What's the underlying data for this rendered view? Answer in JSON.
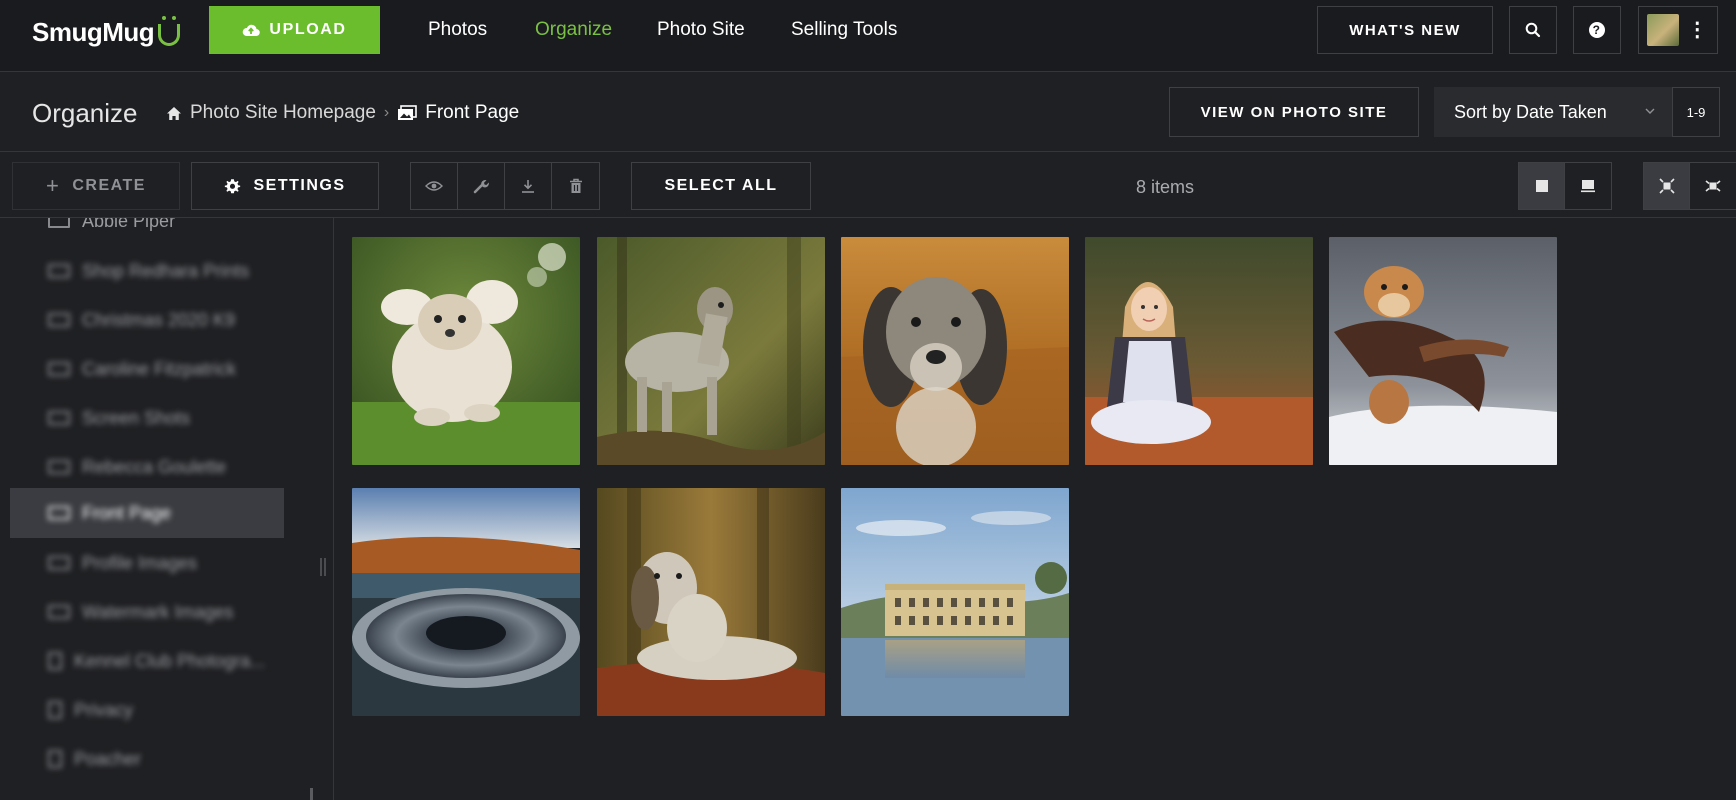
{
  "app": {
    "logo_text": "SmugMug",
    "upload_label": "UPLOAD",
    "nav": [
      {
        "label": "Photos",
        "active": false
      },
      {
        "label": "Organize",
        "active": true
      },
      {
        "label": "Photo Site",
        "active": false
      },
      {
        "label": "Selling Tools",
        "active": false
      }
    ],
    "whats_new_label": "WHAT'S NEW",
    "accent_color": "#7ac143"
  },
  "header": {
    "title": "Organize",
    "breadcrumb": [
      {
        "label": "Photo Site Homepage",
        "icon": "home-icon"
      },
      {
        "label": "Front Page",
        "icon": "gallery-icon"
      }
    ],
    "view_on_site_label": "VIEW ON PHOTO SITE",
    "sort_label": "Sort by Date Taken",
    "range_label": "1-9"
  },
  "toolbar": {
    "create_label": "CREATE",
    "settings_label": "SETTINGS",
    "tools": [
      "eye-icon",
      "wrench-icon",
      "download-icon",
      "trash-icon"
    ],
    "select_all_label": "SELECT ALL",
    "item_count": "8 items",
    "view_modes": [
      "large-thumbnail-icon",
      "details-icon"
    ],
    "fit_modes": [
      "fill-icon",
      "fit-icon"
    ]
  },
  "sidebar": {
    "items": [
      {
        "label": "Abbie Piper",
        "icon": "gallery-icon",
        "active": false
      },
      {
        "label": "Shop Redhara Prints",
        "icon": "gallery-icon",
        "active": false
      },
      {
        "label": "Christmas 2020 K9",
        "icon": "gallery-icon",
        "active": false
      },
      {
        "label": "Caroline Fitzpatrick",
        "icon": "gallery-icon",
        "active": false
      },
      {
        "label": "Screen Shots",
        "icon": "gallery-icon",
        "active": false
      },
      {
        "label": "Rebecca Goulette",
        "icon": "gallery-icon",
        "active": false
      },
      {
        "label": "Front Page",
        "icon": "gallery-icon",
        "active": true
      },
      {
        "label": "Profile Images",
        "icon": "gallery-icon",
        "active": false
      },
      {
        "label": "Watermark Images",
        "icon": "gallery-icon",
        "active": false
      },
      {
        "label": "Kennel Club Photogra...",
        "icon": "page-icon",
        "active": false
      },
      {
        "label": "Privacy",
        "icon": "page-icon",
        "active": false
      },
      {
        "label": "Poacher",
        "icon": "page-icon",
        "active": false
      }
    ]
  },
  "photos": [
    {
      "subject": "long-haired white dog running on grass"
    },
    {
      "subject": "setter dog standing in woodland"
    },
    {
      "subject": "setter dog portrait in golden grass"
    },
    {
      "subject": "young girl sitting in autumn leaves"
    },
    {
      "subject": "retriever carrying pheasant in snow"
    },
    {
      "subject": "reservoir bellmouth overflow"
    },
    {
      "subject": "setter dog lying in autumn leaves"
    },
    {
      "subject": "stately home reflected in lake"
    }
  ]
}
